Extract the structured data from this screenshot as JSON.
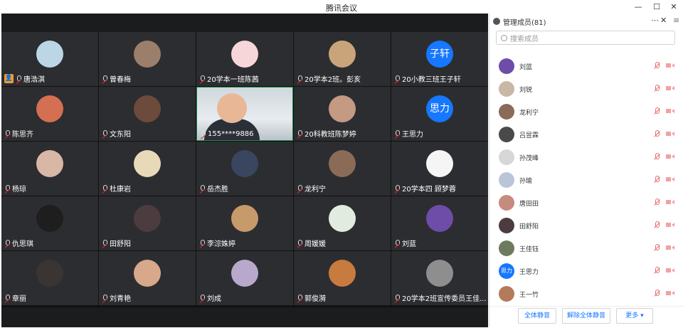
{
  "app": {
    "title": "腾讯会议"
  },
  "window": {
    "minimize": "—",
    "maximize": "☐",
    "close": "✕"
  },
  "grid": {
    "tiles": [
      {
        "name": "唐浩淇",
        "avatar": "#bcd6e6",
        "host": true
      },
      {
        "name": "曾春梅",
        "avatar": "#9b7f6b"
      },
      {
        "name": "20学本一班陈茜",
        "avatar": "#f7d6d9"
      },
      {
        "name": "20学本2班。彭亥",
        "avatar": "#c9a47b"
      },
      {
        "name": "20小教三班王子轩",
        "avatar_text": "子轩"
      },
      {
        "name": "陈思齐",
        "avatar": "#d46f52"
      },
      {
        "name": "文东阳",
        "avatar": "#6c4b3c"
      },
      {
        "name": "155****9886",
        "camera": true
      },
      {
        "name": "20科教班陈梦婷",
        "avatar": "#c59a82"
      },
      {
        "name": "王思力",
        "avatar_text": "思力"
      },
      {
        "name": "杨琼",
        "avatar": "#d8b7a6"
      },
      {
        "name": "杜康岩",
        "avatar": "#e8d9b9"
      },
      {
        "name": "岳杰胜",
        "avatar": "#3a4660"
      },
      {
        "name": "龙利宁",
        "avatar": "#8a6b57"
      },
      {
        "name": "20学本四 顾梦蓉",
        "avatar": "#f5f5f5"
      },
      {
        "name": "仇思琪",
        "avatar": "#1e1e1e"
      },
      {
        "name": "田舒阳",
        "avatar": "#4c3b3f"
      },
      {
        "name": "李淙姝婷",
        "avatar": "#c79a6a"
      },
      {
        "name": "周媛媛",
        "avatar": "#e2ebdf"
      },
      {
        "name": "刘蓝",
        "avatar": "#6d4da8"
      },
      {
        "name": "章丽",
        "avatar": "#3a3432"
      },
      {
        "name": "刘青艳",
        "avatar": "#d8a88a"
      },
      {
        "name": "刘成",
        "avatar": "#b8a9cc"
      },
      {
        "name": "郭俊漪",
        "avatar": "#c77b3e"
      },
      {
        "name": "20学本2班宣传委员王佳...",
        "avatar": "#8e8e8e"
      }
    ]
  },
  "panel": {
    "title": "管理成员(81)",
    "search_placeholder": "搜索成员",
    "members": [
      {
        "name": "刘蓝",
        "avatar": "#6d4da8"
      },
      {
        "name": "刘锐",
        "avatar": "#c9b8a6"
      },
      {
        "name": "龙利宁",
        "avatar": "#8a6b57"
      },
      {
        "name": "吕昱霖",
        "avatar": "#4a4a4a"
      },
      {
        "name": "孙茂峰",
        "avatar": "#d7d7d7"
      },
      {
        "name": "孙瑜",
        "avatar": "#b9c6d8"
      },
      {
        "name": "唐田田",
        "avatar": "#c58b7e"
      },
      {
        "name": "田舒阳",
        "avatar": "#4c3b3f"
      },
      {
        "name": "王佳钰",
        "avatar": "#6e7a5f"
      },
      {
        "name": "王思力",
        "avatar_text": "思力"
      },
      {
        "name": "王一竹",
        "avatar": "#b37a5b"
      }
    ],
    "footer": {
      "mute_all": "全体静音",
      "unmute_all": "解除全体静音",
      "more": "更多 ▾"
    }
  }
}
